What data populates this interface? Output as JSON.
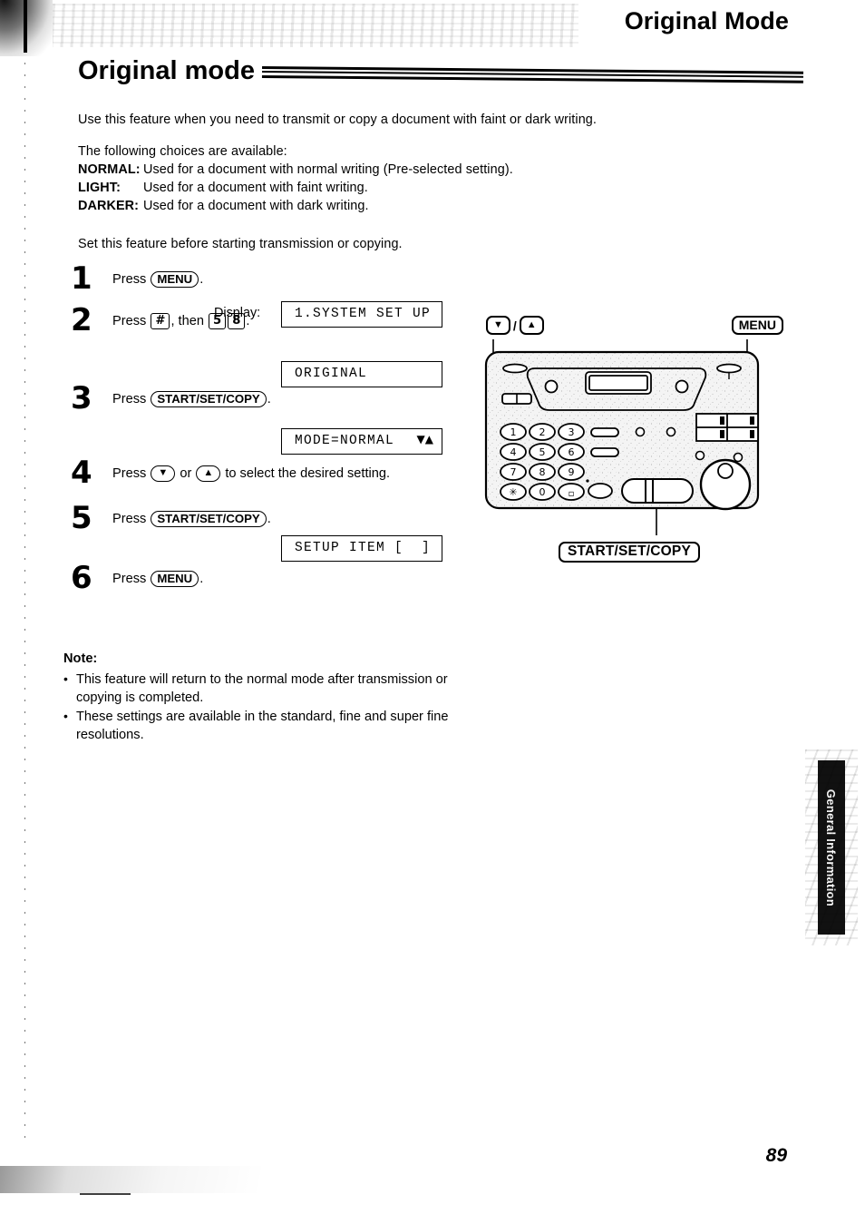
{
  "running_head": "Original Mode",
  "title": "Original mode",
  "intro": "Use this feature when you need to transmit or copy a document with faint or dark writing.",
  "choices_lead": "The following choices are available:",
  "choices": [
    {
      "label": "NORMAL:",
      "text": "Used for a document with normal writing (Pre-selected setting)."
    },
    {
      "label": "LIGHT:",
      "text": "Used for a document with faint writing."
    },
    {
      "label": "DARKER:",
      "text": "Used for a document with dark writing."
    }
  ],
  "set_before": "Set this feature before starting transmission or copying.",
  "display_label": "Display:",
  "steps": [
    {
      "num": "1",
      "press_word": "Press",
      "key": "MENU",
      "trailing": ".",
      "display": "1.SYSTEM SET UP",
      "display_arrows": ""
    },
    {
      "num": "2",
      "press_word": "Press",
      "key": "#",
      "then_word": ", then",
      "key2": "5",
      "key3": "8",
      "trailing": ".",
      "display": "ORIGINAL",
      "display_arrows": ""
    },
    {
      "num": "3",
      "press_word": "Press",
      "key": "START/SET/COPY",
      "trailing": ".",
      "display": "MODE=NORMAL",
      "display_arrows": "▼▲"
    },
    {
      "num": "4",
      "press_word": "Press",
      "key": "▼",
      "or_word": "or",
      "key2": "▲",
      "trailing": "to select the desired setting."
    },
    {
      "num": "5",
      "press_word": "Press",
      "key": "START/SET/COPY",
      "trailing": ".",
      "display": "SETUP ITEM [  ]",
      "display_arrows": ""
    },
    {
      "num": "6",
      "press_word": "Press",
      "key": "MENU",
      "trailing": "."
    }
  ],
  "note": {
    "title": "Note:",
    "items": [
      "This feature will return to the normal mode after transmission or copying is completed.",
      "These settings are available in the standard, fine and super fine resolutions."
    ]
  },
  "diagram": {
    "callout_updown_down": "▼",
    "callout_updown_sep": "/",
    "callout_updown_up": "▲",
    "callout_menu": "MENU",
    "callout_start": "START/SET/COPY",
    "keypad": [
      "1",
      "2",
      "3",
      "4",
      "5",
      "6",
      "7",
      "8",
      "9",
      "✱",
      "0",
      "□"
    ]
  },
  "side_tab": "General Information",
  "folio": "89",
  "colors": {
    "ink": "#000000",
    "paper": "#ffffff",
    "panel_fill": "#f2f2f2",
    "tab_bg": "#111111"
  }
}
